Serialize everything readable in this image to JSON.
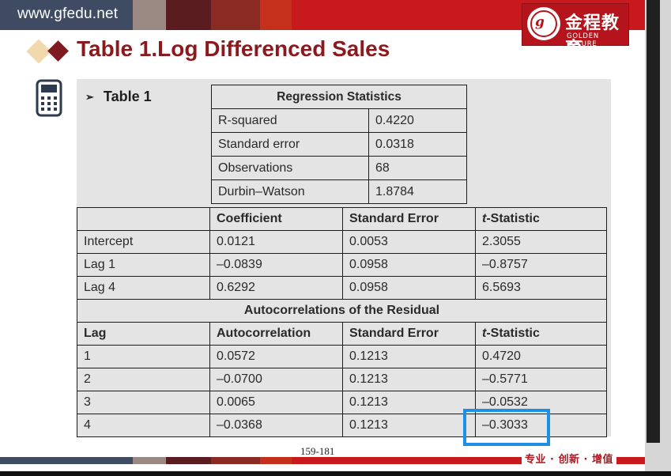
{
  "header": {
    "site_url": "www.gfedu.net",
    "band_colors": [
      "#3f4b63",
      "#9a8a83",
      "#5a1c1f",
      "#8a2a22",
      "#c5301c",
      "#c8191d"
    ]
  },
  "logo": {
    "chinese_name": "金程教育",
    "english_name": "GOLDEN FUTURE",
    "brand_color": "#b5141c"
  },
  "page_title": "Table 1.Log Differenced Sales",
  "table_label": "Table 1",
  "regression_statistics": {
    "title": "Regression Statistics",
    "rows": [
      {
        "label": "R-squared",
        "value": "0.4220"
      },
      {
        "label": "Standard error",
        "value": "0.0318"
      },
      {
        "label": "Observations",
        "value": "68"
      },
      {
        "label": "Durbin–Watson",
        "value": "1.8784"
      }
    ]
  },
  "coefficients": {
    "headers": [
      "",
      "Coefficient",
      "Standard Error",
      "t",
      "-Statistic"
    ],
    "rows": [
      [
        "Intercept",
        "0.0121",
        "0.0053",
        "2.3055"
      ],
      [
        "Lag 1",
        "–0.0839",
        "0.0958",
        "–0.8757"
      ],
      [
        "Lag 4",
        "0.6292",
        "0.0958",
        "6.5693"
      ]
    ]
  },
  "autocorrelations": {
    "title": "Autocorrelations of the Residual",
    "headers": [
      "Lag",
      "Autocorrelation",
      "Standard Error",
      "t",
      "-Statistic"
    ],
    "rows": [
      [
        "1",
        "0.0572",
        "0.1213",
        "0.4720"
      ],
      [
        "2",
        "–0.0700",
        "0.1213",
        "–0.5771"
      ],
      [
        "3",
        "0.0065",
        "0.1213",
        "–0.0532"
      ],
      [
        "4",
        "–0.0368",
        "0.1213",
        "–0.3033"
      ]
    ]
  },
  "highlight_color": "#1e8fe6",
  "page_number": "159-181",
  "slogan": "专业 · 创新 · 增值"
}
